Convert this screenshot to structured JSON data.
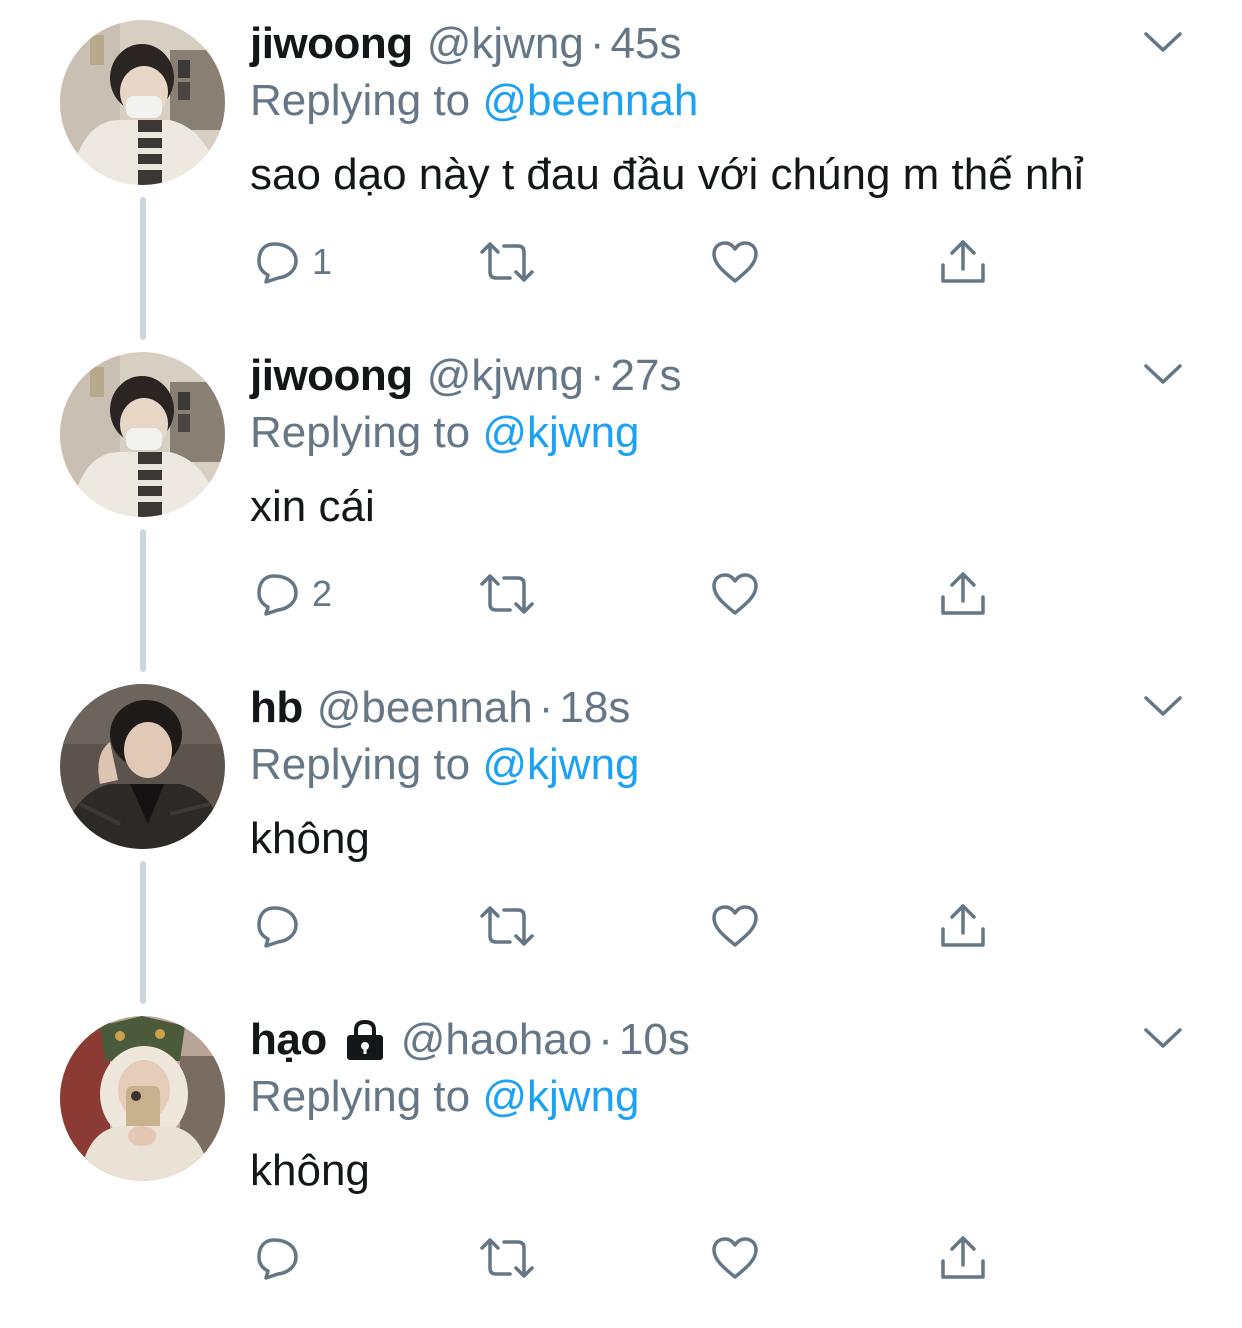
{
  "colors": {
    "text_primary": "#14171a",
    "text_secondary": "#657786",
    "mention": "#1da1f2",
    "thread_line": "#ccd6dd"
  },
  "tweets": [
    {
      "display_name": "jiwoong",
      "handle": "@kjwng",
      "separator": "·",
      "time": "45s",
      "replying_prefix": "Replying to ",
      "replying_to": "@beennah",
      "text": "sao dạo này t đau đầu với chúng m thế nhỉ",
      "reply_count": "1",
      "locked": false,
      "avatar": "avatar-jiwoong"
    },
    {
      "display_name": "jiwoong",
      "handle": "@kjwng",
      "separator": "·",
      "time": "27s",
      "replying_prefix": "Replying to ",
      "replying_to": "@kjwng",
      "text": "xin cái",
      "reply_count": "2",
      "locked": false,
      "avatar": "avatar-jiwoong"
    },
    {
      "display_name": "hb",
      "handle": "@beennah",
      "separator": "·",
      "time": "18s",
      "replying_prefix": "Replying to ",
      "replying_to": "@kjwng",
      "text": "không",
      "reply_count": "",
      "locked": false,
      "avatar": "avatar-hb"
    },
    {
      "display_name": "hạo",
      "handle": "@haohao",
      "separator": "·",
      "time": "10s",
      "replying_prefix": "Replying to ",
      "replying_to": "@kjwng",
      "text": "không",
      "reply_count": "",
      "locked": true,
      "avatar": "avatar-hao"
    }
  ],
  "icons": {
    "reply": "reply-icon",
    "retweet": "retweet-icon",
    "like": "like-icon",
    "share": "share-icon",
    "caret": "chevron-down-icon",
    "lock": "lock-icon"
  }
}
